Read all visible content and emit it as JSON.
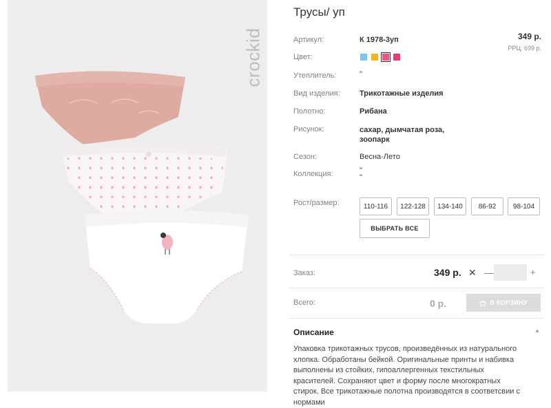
{
  "brand": {
    "logo_text": "crockid"
  },
  "product": {
    "title": "Трусы/ уп",
    "price": "349 р.",
    "rrp": "РРЦ: 699 р."
  },
  "specs": [
    {
      "label": "Артикул:",
      "value": "К 1978-3уп"
    },
    {
      "label": "Цвет:",
      "value": ""
    },
    {
      "label": "Утеплитель:",
      "value": "\""
    },
    {
      "label": "Вид изделия:",
      "value": "Трикотажные изделия"
    },
    {
      "label": "Полотно:",
      "value": "Рибана"
    },
    {
      "label": "Рисунок:",
      "value": "сахар, дымчатая роза, зоопарк"
    },
    {
      "label": "Сезон:",
      "value": "Весна-Лето"
    },
    {
      "label": "Коллекция:",
      "value": "\"\n\""
    }
  ],
  "colors": [
    "#7fc3ee",
    "#f3b51b",
    "#f2527d",
    "#ea3a78"
  ],
  "sizes": {
    "label": "Рост/размер:",
    "options": [
      "110-116",
      "122-128",
      "134-140",
      "86-92",
      "98-104"
    ],
    "select_all": "ВЫБРАТЬ ВСЕ"
  },
  "order": {
    "label": "Заказ:",
    "price": "349 р.",
    "times": "✕",
    "minus": "—",
    "plus": "+",
    "qty": ""
  },
  "total": {
    "label": "Всего:",
    "value": "0 р.",
    "cart_button": "В КОРЗИНУ"
  },
  "description": {
    "heading": "Описание",
    "text": "Упаковка трикотажных трусов, произведённых из натурального хлопка. Обработаны бейкой. Оригинальные принты и набивка выполнены из стойких, гипоаллергенных текстильных красителей. Сохраняют цвет и форму после многократных стирок. Все трикотажные полотна производятся в соответсвии с нормами"
  }
}
